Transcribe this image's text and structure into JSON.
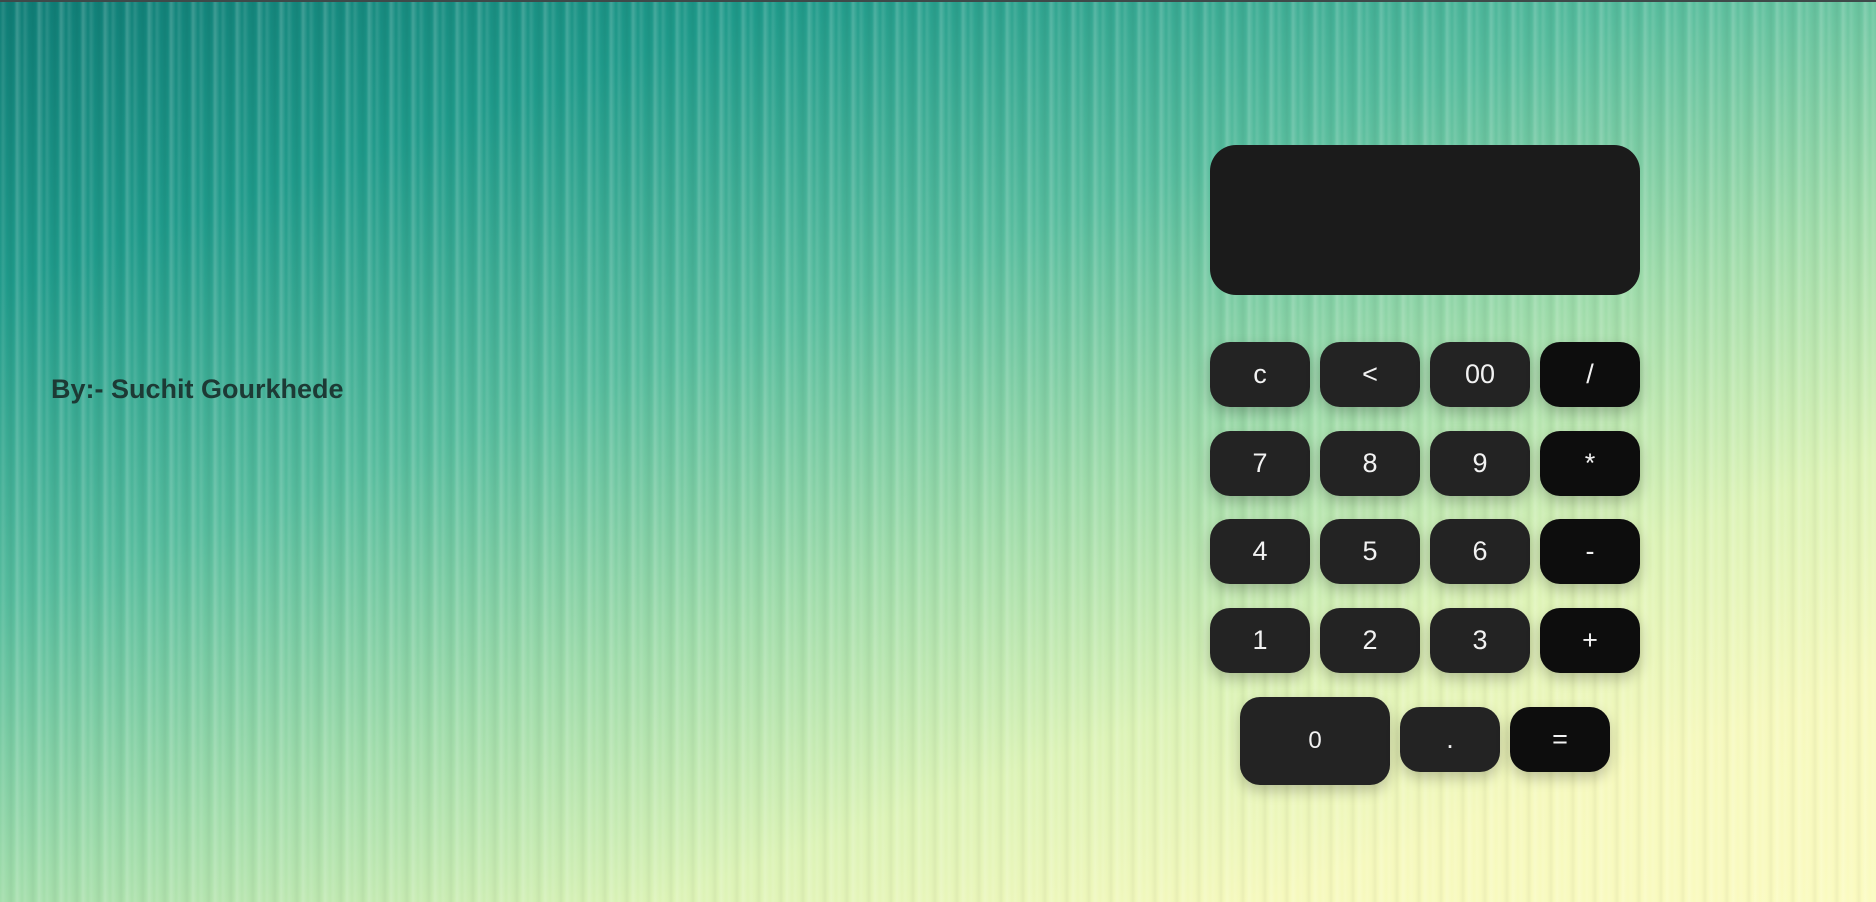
{
  "page": {
    "author_label": "By:- Suchit Gourkhede"
  },
  "calculator": {
    "display_value": "",
    "keys": {
      "clear": "c",
      "backspace": "<",
      "double_zero": "00",
      "divide": "/",
      "seven": "7",
      "eight": "8",
      "nine": "9",
      "multiply": "*",
      "four": "4",
      "five": "5",
      "six": "6",
      "subtract": "-",
      "one": "1",
      "two": "2",
      "three": "3",
      "add": "+",
      "zero": "0",
      "decimal": ".",
      "equals": "="
    },
    "colors": {
      "display": "#1b1b1b",
      "number_key": "#232323",
      "operator_key": "#0d0d0d",
      "key_text": "#f2f2f2"
    }
  }
}
